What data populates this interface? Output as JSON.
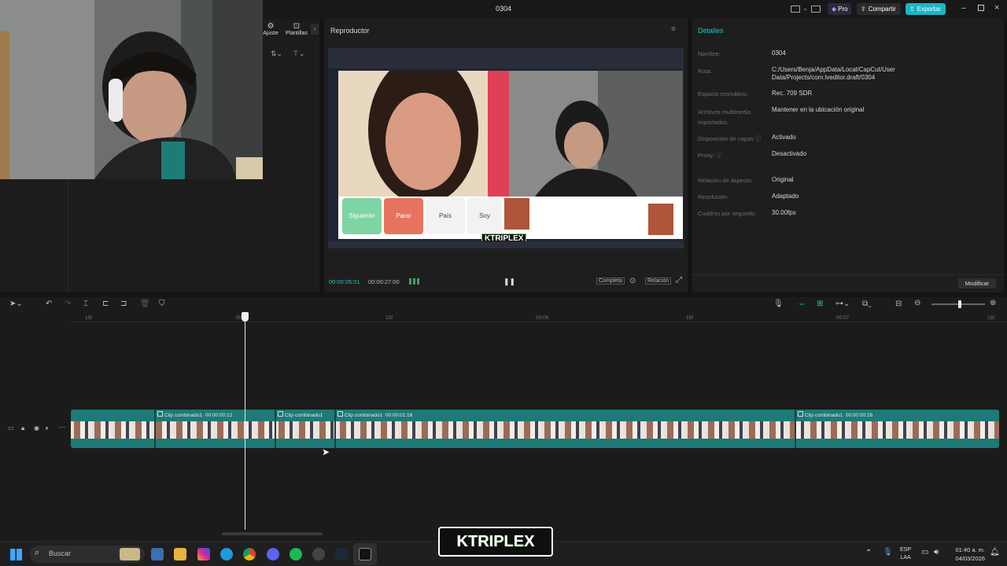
{
  "window": {
    "title": "0304",
    "pro_label": "Pro",
    "share_label": "Compartir",
    "export_label": "Exportar"
  },
  "left_toolbar": {
    "adjust_label": "Ajuste",
    "templates_label": "Plantillas"
  },
  "player": {
    "title": "Reproductor",
    "current_time": "00:00:05:01",
    "total_time": "00:00:27:00",
    "complete_label": "Completa",
    "ratio_label": "Relación",
    "preview": {
      "buttons": [
        "Siguiente",
        "Parar",
        "País",
        "Soy"
      ],
      "watermark": "KTRIPLEX"
    }
  },
  "details": {
    "title": "Detalles",
    "rows": [
      {
        "label": "Nombre:",
        "value": "0304"
      },
      {
        "label": "Ruta:",
        "value": "C:/Users/Benja/AppData/Local/CapCut/User Data/Projects/com.lveditor.draft/0304"
      },
      {
        "label": "Espacio cromático:",
        "value": "Rec. 709 SDR"
      },
      {
        "label": "Archivos multimedia importados:",
        "value": "Mantener en la ubicación original"
      },
      {
        "label": "Disposición de capas",
        "value": "Activado"
      },
      {
        "label": "Proxy:",
        "value": "Desactivado"
      },
      {
        "label": "Relación de aspecto:",
        "value": "Original"
      },
      {
        "label": "Resolución:",
        "value": "Adaptado"
      },
      {
        "label": "Cuadros por segundo:",
        "value": "30.00fps"
      }
    ],
    "modify_label": "Modificar"
  },
  "timeline": {
    "ruler": [
      "15f",
      "00:00",
      "15f",
      "00:06",
      "15f",
      "00:07",
      "15f"
    ],
    "clips": [
      {
        "name": "Clip combinado1",
        "duration": "00:00:00:12"
      },
      {
        "name": "Clip combinado1",
        "duration": ""
      },
      {
        "name": "Clip combinado1",
        "duration": "00:00:01:16"
      },
      {
        "name": "Clip combinado1",
        "duration": "00:00:00:26"
      }
    ]
  },
  "taskbar": {
    "search_placeholder": "Buscar",
    "lang_top": "ESP",
    "lang_bottom": "LAA",
    "time": "01:40 a. m.",
    "date": "04/03/2026"
  },
  "overlay_logo": "KTRIPLEX",
  "colors": {
    "accent": "#21c7c7",
    "clip_teal": "#1f7f7c",
    "export_bg": "#1bb6c5",
    "pro_bg": "#2e2e3e"
  }
}
